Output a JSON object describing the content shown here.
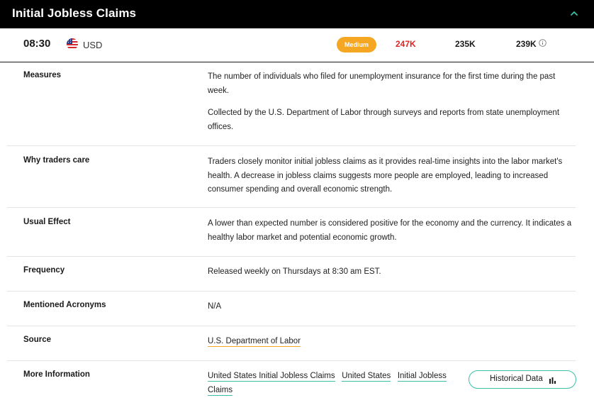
{
  "header": {
    "title": "Initial Jobless Claims",
    "collapse_icon": "chevron-up-icon",
    "accent": "#3bbfa8"
  },
  "event": {
    "time": "08:30",
    "flag_icon": "us-flag-icon",
    "currency": "USD",
    "impact": "Medium",
    "impact_color": "#f5a623",
    "actual": "247K",
    "actual_color": "#e02424",
    "forecast": "235K",
    "previous": "239K",
    "info_icon": "info-icon"
  },
  "details": {
    "measures": {
      "label": "Measures",
      "text1": "The number of individuals who filed for unemployment insurance for the first time during the past week.",
      "text2": "Collected by the U.S. Department of Labor through surveys and reports from state unemployment offices."
    },
    "why": {
      "label": "Why traders care",
      "text": "Traders closely monitor initial jobless claims as it provides real-time insights into the labor market's health. A decrease in jobless claims suggests more people are employed, leading to increased consumer spending and overall economic strength."
    },
    "effect": {
      "label": "Usual Effect",
      "text": "A lower than expected number is considered positive for the economy and the currency. It indicates a healthy labor market and potential economic growth."
    },
    "frequency": {
      "label": "Frequency",
      "text": "Released weekly on Thursdays at 8:30 am EST."
    },
    "acronyms": {
      "label": "Mentioned Acronyms",
      "text": "N/A"
    },
    "source": {
      "label": "Source",
      "link": "U.S. Department of Labor"
    },
    "more": {
      "label": "More Information",
      "links": [
        "United States Initial Jobless Claims",
        "United States",
        "Initial Jobless Claims"
      ],
      "button": "Historical Data",
      "button_icon": "bar-chart-icon"
    }
  }
}
